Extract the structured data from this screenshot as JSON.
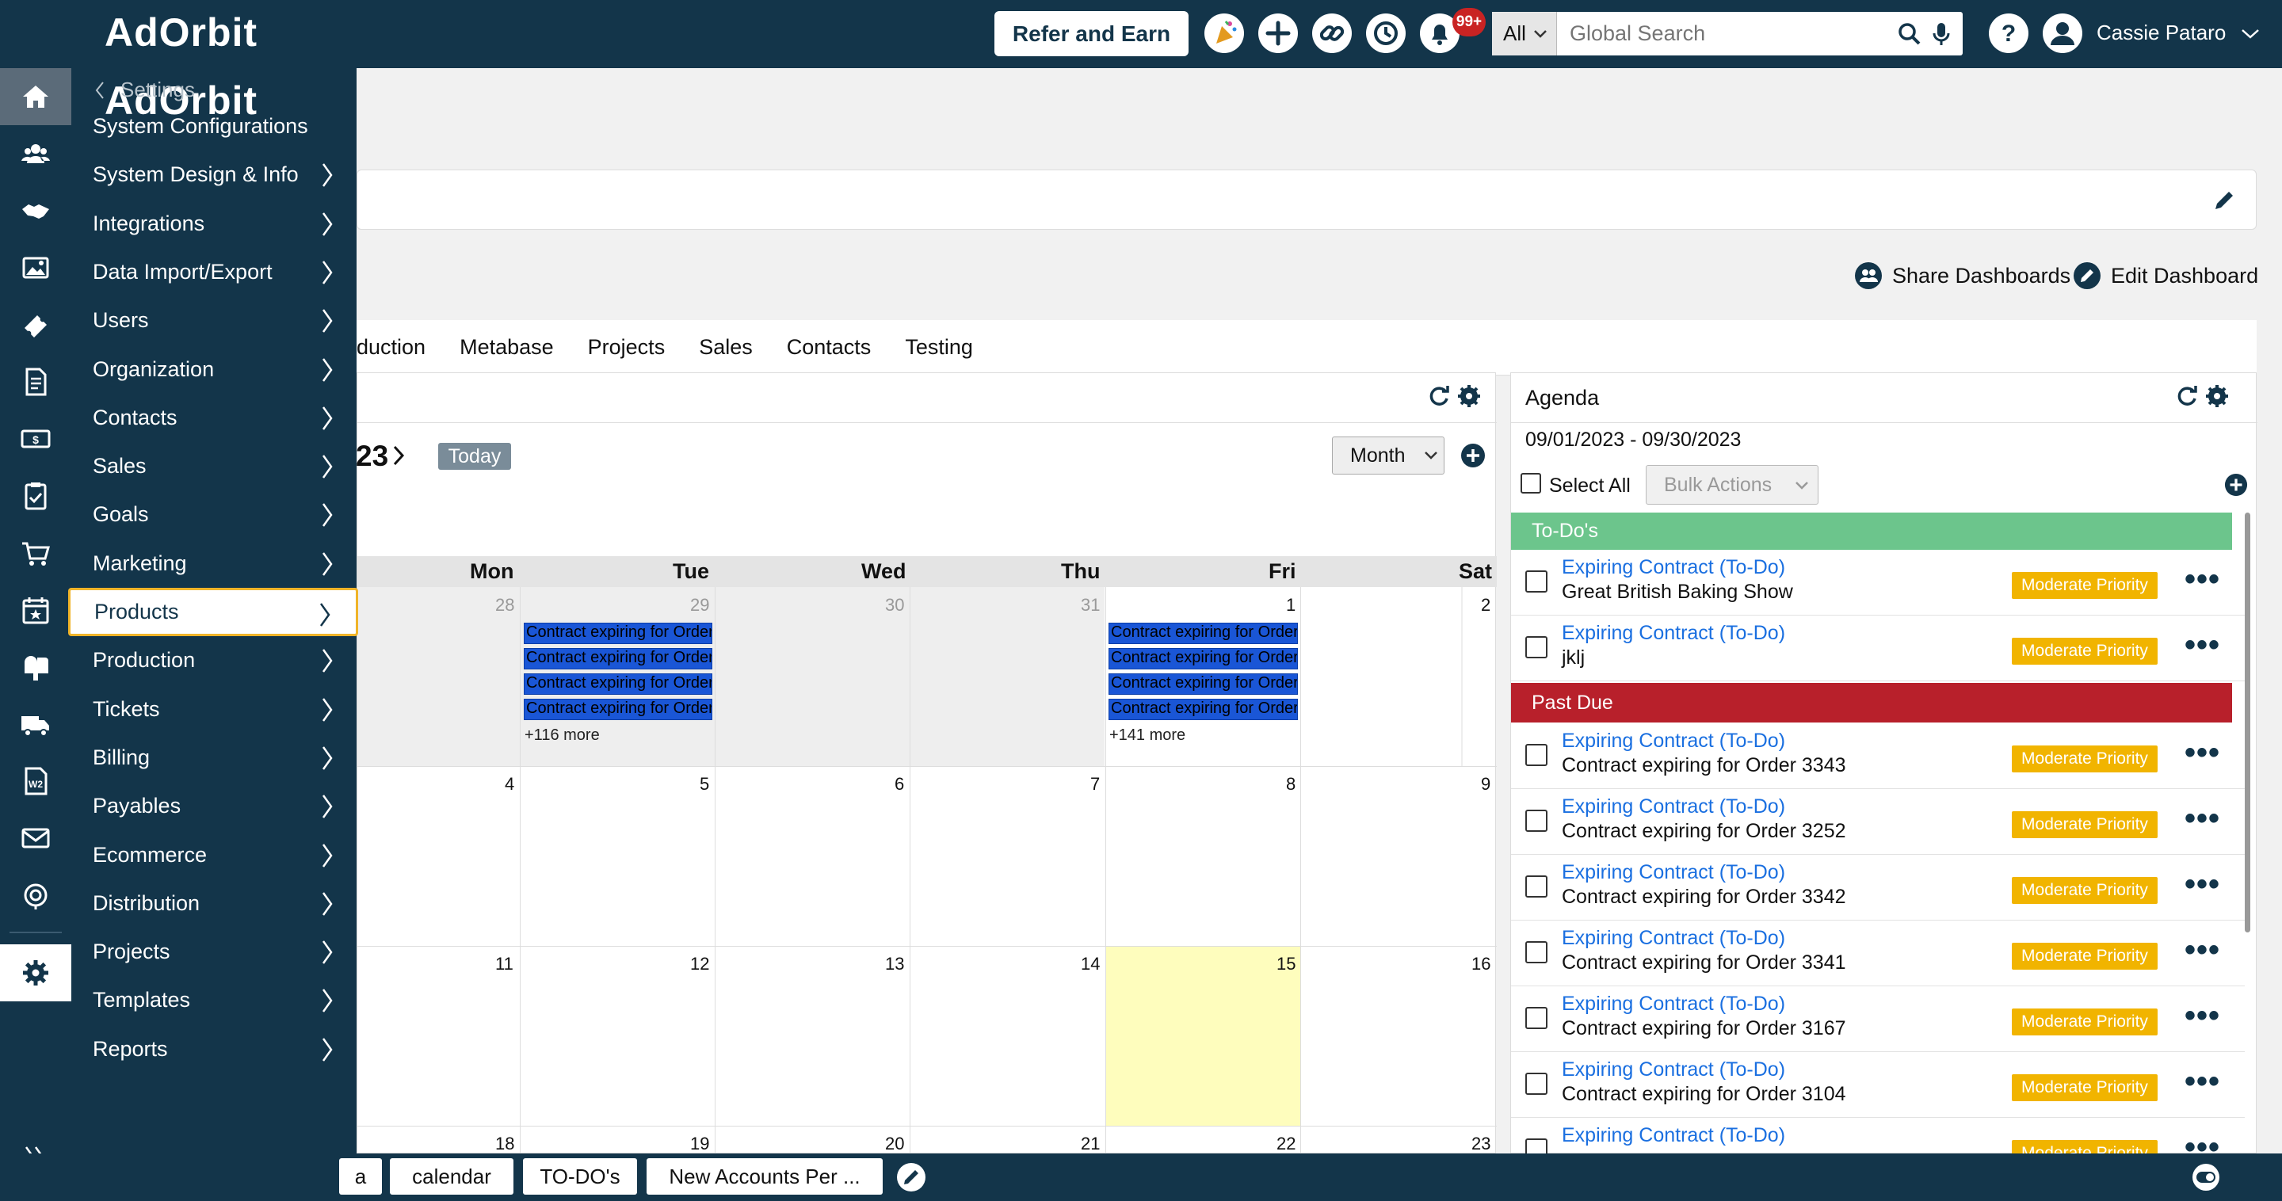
{
  "brand": {
    "logo": "AdOrbit"
  },
  "topbar": {
    "refer_label": "Refer and Earn",
    "notif_count": "99+",
    "search_scope": "All",
    "search_placeholder": "Global Search",
    "user_name": "Cassie Pataro"
  },
  "rail": {
    "icons": [
      "home-icon",
      "people-icon",
      "handshake-icon",
      "image-icon",
      "ticket-icon",
      "document-icon",
      "billing-icon",
      "clipboard-icon",
      "cart-icon",
      "calendar-icon",
      "mailbox-icon",
      "truck-icon",
      "w2-icon",
      "mail-icon",
      "orbit-icon",
      "gear-icon",
      "expand-icon"
    ]
  },
  "menu": {
    "back_label": "Settings",
    "items": [
      {
        "label": "System Configurations"
      },
      {
        "label": "System Design & Info"
      },
      {
        "label": "Integrations"
      },
      {
        "label": "Data Import/Export"
      },
      {
        "label": "Users"
      },
      {
        "label": "Organization"
      },
      {
        "label": "Contacts"
      },
      {
        "label": "Sales"
      },
      {
        "label": "Goals"
      },
      {
        "label": "Marketing"
      },
      {
        "label": "Products"
      },
      {
        "label": "Production"
      },
      {
        "label": "Tickets"
      },
      {
        "label": "Billing"
      },
      {
        "label": "Payables"
      },
      {
        "label": "Ecommerce"
      },
      {
        "label": "Distribution"
      },
      {
        "label": "Projects"
      },
      {
        "label": "Templates"
      },
      {
        "label": "Reports"
      }
    ],
    "selected": "Products"
  },
  "dashboard": {
    "share_label": "Share Dashboards",
    "edit_label": "Edit Dashboard",
    "tabs": [
      "duction",
      "Metabase",
      "Projects",
      "Sales",
      "Contacts",
      "Testing"
    ]
  },
  "calendar": {
    "month_fragment": "23",
    "today_label": "Today",
    "view_select": "Month",
    "day_headers": [
      "Mon",
      "Tue",
      "Wed",
      "Thu",
      "Fri",
      "Sat"
    ],
    "weeks": [
      [
        "28",
        "29",
        "30",
        "31",
        "1",
        "2"
      ],
      [
        "4",
        "5",
        "6",
        "7",
        "8",
        "9"
      ],
      [
        "11",
        "12",
        "13",
        "14",
        "15",
        "16"
      ],
      [
        "18",
        "19",
        "20",
        "21",
        "22",
        "23"
      ]
    ],
    "event_text": "Contract expiring for Order",
    "tue_more": "+116 more",
    "fri_more": "+141 more"
  },
  "agenda": {
    "title": "Agenda",
    "date_range": "09/01/2023 - 09/30/2023",
    "select_all": "Select All",
    "bulk_actions": "Bulk Actions",
    "todos_header": "To-Do's",
    "pastdue_header": "Past Due",
    "todos": [
      {
        "title": "Expiring Contract (To-Do)",
        "sub": "Great British Baking Show",
        "priority": "Moderate Priority"
      },
      {
        "title": "Expiring Contract (To-Do)",
        "sub": "jklj",
        "priority": "Moderate Priority"
      }
    ],
    "pastdue": [
      {
        "title": "Expiring Contract (To-Do)",
        "sub": "Contract expiring for Order 3343",
        "priority": "Moderate Priority"
      },
      {
        "title": "Expiring Contract (To-Do)",
        "sub": "Contract expiring for Order 3252",
        "priority": "Moderate Priority"
      },
      {
        "title": "Expiring Contract (To-Do)",
        "sub": "Contract expiring for Order 3342",
        "priority": "Moderate Priority"
      },
      {
        "title": "Expiring Contract (To-Do)",
        "sub": "Contract expiring for Order 3341",
        "priority": "Moderate Priority"
      },
      {
        "title": "Expiring Contract (To-Do)",
        "sub": "Contract expiring for Order 3167",
        "priority": "Moderate Priority"
      },
      {
        "title": "Expiring Contract (To-Do)",
        "sub": "Contract expiring for Order 3104",
        "priority": "Moderate Priority"
      },
      {
        "title": "Expiring Contract (To-Do)",
        "sub": "",
        "priority": "Moderate Priority"
      }
    ]
  },
  "footer": {
    "tabs": [
      "a",
      "calendar",
      "TO-DO's",
      "New Accounts Per ..."
    ]
  },
  "colors": {
    "navy": "#13354a",
    "todo_green": "#6cc58c",
    "pastdue_red": "#b8202b",
    "priority_yellow": "#f1b400",
    "event_blue": "#1a56d6",
    "today_yellow": "#fefdbd",
    "focus_gold": "#f0b429"
  }
}
